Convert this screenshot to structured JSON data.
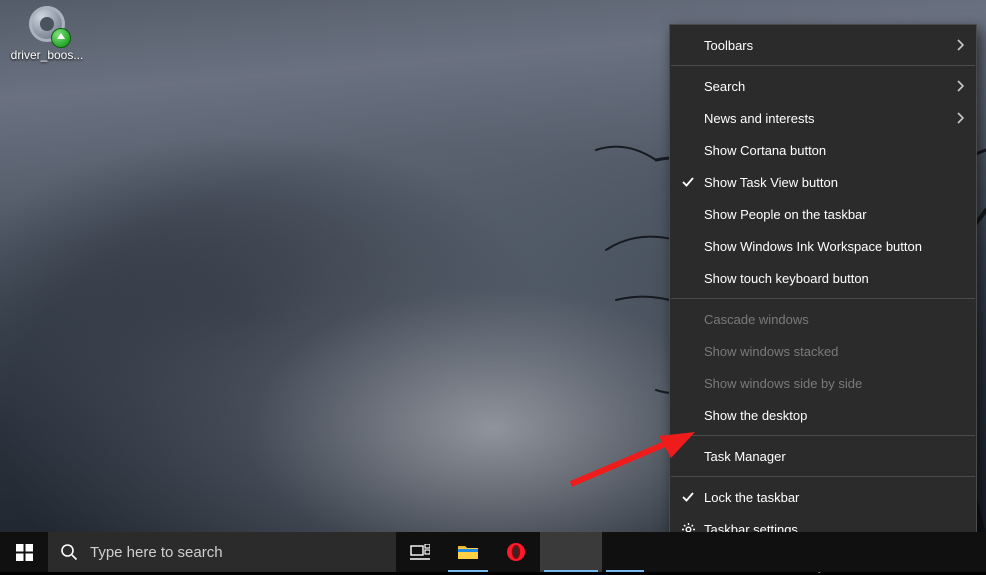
{
  "desktop": {
    "icons": [
      {
        "name": "driver-booster",
        "label": "driver_boos..."
      }
    ]
  },
  "taskbar": {
    "search_placeholder": "Type here to search"
  },
  "context_menu": {
    "items": [
      {
        "label": "Toolbars",
        "type": "submenu"
      },
      {
        "type": "separator"
      },
      {
        "label": "Search",
        "type": "submenu"
      },
      {
        "label": "News and interests",
        "type": "submenu"
      },
      {
        "label": "Show Cortana button",
        "type": "toggle",
        "checked": false
      },
      {
        "label": "Show Task View button",
        "type": "toggle",
        "checked": true
      },
      {
        "label": "Show People on the taskbar",
        "type": "toggle",
        "checked": false
      },
      {
        "label": "Show Windows Ink Workspace button",
        "type": "toggle",
        "checked": false
      },
      {
        "label": "Show touch keyboard button",
        "type": "toggle",
        "checked": false
      },
      {
        "type": "separator"
      },
      {
        "label": "Cascade windows",
        "type": "action",
        "disabled": true
      },
      {
        "label": "Show windows stacked",
        "type": "action",
        "disabled": true
      },
      {
        "label": "Show windows side by side",
        "type": "action",
        "disabled": true
      },
      {
        "label": "Show the desktop",
        "type": "action"
      },
      {
        "type": "separator"
      },
      {
        "label": "Task Manager",
        "type": "action"
      },
      {
        "type": "separator"
      },
      {
        "label": "Lock the taskbar",
        "type": "toggle",
        "checked": true
      },
      {
        "label": "Taskbar settings",
        "type": "action",
        "icon": "gear"
      }
    ]
  }
}
